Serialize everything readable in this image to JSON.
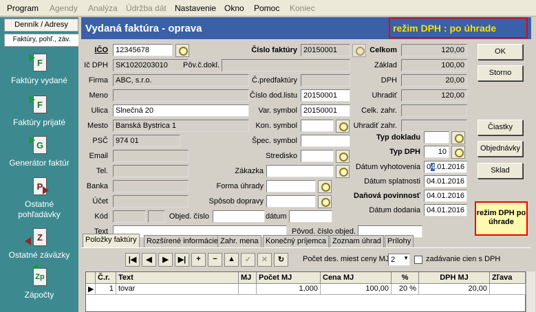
{
  "menu": {
    "items": [
      {
        "label": "Program",
        "enabled": true
      },
      {
        "label": "Agendy",
        "enabled": false
      },
      {
        "label": "Analýza",
        "enabled": false
      },
      {
        "label": "Údržba dát",
        "enabled": false
      },
      {
        "label": "Nastavenie",
        "enabled": true
      },
      {
        "label": "Okno",
        "enabled": true
      },
      {
        "label": "Pomoc",
        "enabled": true
      },
      {
        "label": "Koniec",
        "enabled": false
      }
    ]
  },
  "sidebar": {
    "tabs": [
      "Denník / Adresy",
      "Faktúry, pohľ., záv."
    ],
    "items": [
      {
        "label": "Faktúry vydané",
        "letter": "F",
        "icon": "issued-invoices-icon"
      },
      {
        "label": "Faktúry prijaté",
        "letter": "F",
        "icon": "received-invoices-icon"
      },
      {
        "label": "Generátor faktúr",
        "letter": "G",
        "icon": "invoice-generator-icon"
      },
      {
        "label": "Ostatné pohľadávky",
        "letter": "P",
        "icon": "receivables-icon"
      },
      {
        "label": "Ostatné záväzky",
        "letter": "Z",
        "icon": "liabilities-icon"
      },
      {
        "label": "Zápočty",
        "letter": "Zp",
        "icon": "offsets-icon"
      }
    ]
  },
  "window": {
    "title": "Vydaná faktúra  -  oprava",
    "mode_badge": "režim DPH : po úhrade",
    "mode_box": "režim DPH po úhrade"
  },
  "form": {
    "ico": {
      "label": "IČO",
      "value": "12345678"
    },
    "ic_dph": {
      "label": "Ič DPH",
      "value": "SK1020203010"
    },
    "pov_c_dokl": {
      "label": "Pôv.č.dokl.",
      "value": ""
    },
    "firma": {
      "label": "Firma",
      "value": "ABC, s.r.o."
    },
    "meno": {
      "label": "Meno",
      "value": ""
    },
    "ulica": {
      "label": "Ulica",
      "value": "Slnečná 20"
    },
    "mesto": {
      "label": "Mesto",
      "value": "Banská Bystrica 1"
    },
    "psc": {
      "label": "PSČ",
      "value": "974 01"
    },
    "email": {
      "label": "Email",
      "value": ""
    },
    "tel": {
      "label": "Tel.",
      "value": ""
    },
    "banka": {
      "label": "Banka",
      "value": ""
    },
    "ucet": {
      "label": "Účet",
      "value": ""
    },
    "kod": {
      "label": "Kód",
      "value": ""
    },
    "text": {
      "label": "Text",
      "value": ""
    },
    "cislo_faktury": {
      "label": "Číslo faktúry",
      "value": "20150001"
    },
    "c_predfaktury": {
      "label": "Č.predfaktúry",
      "value": ""
    },
    "cislo_dod_listu": {
      "label": "Číslo dod.listu",
      "value": "20150001"
    },
    "var_symbol": {
      "label": "Var. symbol",
      "value": "20150001"
    },
    "kon_symbol": {
      "label": "Kon. symbol",
      "value": ""
    },
    "spec_symbol": {
      "label": "Špec. symbol",
      "value": ""
    },
    "stredisko": {
      "label": "Stredisko",
      "value": ""
    },
    "zakazka": {
      "label": "Zákazka",
      "value": ""
    },
    "forma_uhrady": {
      "label": "Forma úhrady",
      "value": ""
    },
    "sposob_dopravy": {
      "label": "Spôsob dopravy",
      "value": ""
    },
    "objed_cislo": {
      "label": "Objed. číslo",
      "value": ""
    },
    "datum": {
      "label": "dátum",
      "value": ""
    },
    "pov_cislo_objed": {
      "label": "Pôvod. číslo objed.",
      "value": ""
    },
    "celkom": {
      "label": "Celkom",
      "value": "120,00"
    },
    "zaklad": {
      "label": "Základ",
      "value": "100,00"
    },
    "dph": {
      "label": "DPH",
      "value": "20,00"
    },
    "uhradit": {
      "label": "Uhradiť",
      "value": "120,00"
    },
    "celk_zahr": {
      "label": "Celk. zahr.",
      "value": ""
    },
    "uhradit_zahr": {
      "label": "Uhradiť zahr.",
      "value": ""
    },
    "typ_dokladu": {
      "label": "Typ dokladu",
      "value": ""
    },
    "typ_dph": {
      "label": "Typ DPH",
      "value": "10"
    },
    "datum_vyhotovenia": {
      "label": "Dátum vyhotovenia",
      "value_pre": "0",
      "value_caret": "4",
      "value_post": ".01.2016"
    },
    "datum_splatnosti": {
      "label": "Dátum splatnosti",
      "value": "04.01.2016"
    },
    "danova_povinnost": {
      "label": "Daňová povinnosť",
      "value": "04.01.2016"
    },
    "datum_dodania": {
      "label": "Dátum dodania",
      "value": "04.01.2016"
    }
  },
  "buttons": {
    "ok": "OK",
    "storno": "Storno",
    "ciastky": "Čiastky",
    "objednavky": "Objednávky",
    "sklad": "Sklad"
  },
  "tabs": [
    "Položky faktúry",
    "Rozšírené informácie",
    "Zahr. mena",
    "Konečný príjemca",
    "Zoznam úhrad",
    "Prílohy"
  ],
  "toolbar": {
    "decimals_label": "Počet des. miest ceny MJ",
    "decimals_value": "2",
    "vat_prices_label": "zadávanie cien s DPH",
    "vat_prices_checked": false
  },
  "table": {
    "columns": [
      "Č.r.",
      "Text",
      "MJ",
      "Počet MJ",
      "Cena MJ",
      "%",
      "DPH MJ",
      "Zľava"
    ],
    "rows": [
      [
        "1",
        "tovar",
        "",
        "1,000",
        "100,00",
        "20 %",
        "20,00",
        ""
      ]
    ]
  }
}
